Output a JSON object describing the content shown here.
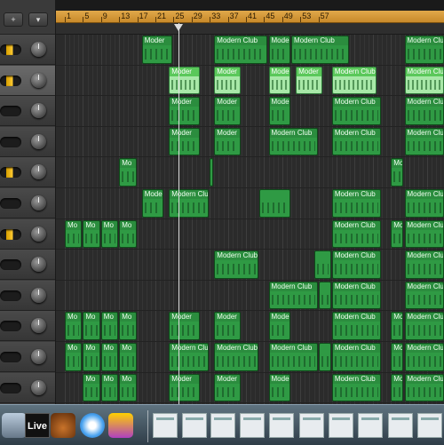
{
  "ruler": {
    "bars": [
      "1",
      "5",
      "9",
      "13",
      "17",
      "21",
      "25",
      "29",
      "33",
      "37",
      "41",
      "45",
      "49",
      "53",
      "57"
    ]
  },
  "region_label": "Modern Club",
  "region_label_short": "Moder",
  "region_label_tiny": "Mo",
  "region_label_mid": "Modern Clu",
  "dock": {
    "live_label": "Live",
    "items": [
      "finder-icon",
      "live-icon",
      "garageband-icon",
      "safari-icon",
      "podcast-icon",
      "window-thumb-1",
      "window-thumb-2",
      "window-thumb-3",
      "window-thumb-4",
      "window-thumb-5",
      "window-thumb-6",
      "window-thumb-7",
      "window-thumb-8",
      "window-thumb-9",
      "window-thumb-10",
      "trash-icon"
    ]
  },
  "colors": {
    "region": "#2f9a44",
    "region_selected": "#a8e8a8",
    "ruler": "#d89a3a",
    "track_meter": "#ffcc33"
  }
}
